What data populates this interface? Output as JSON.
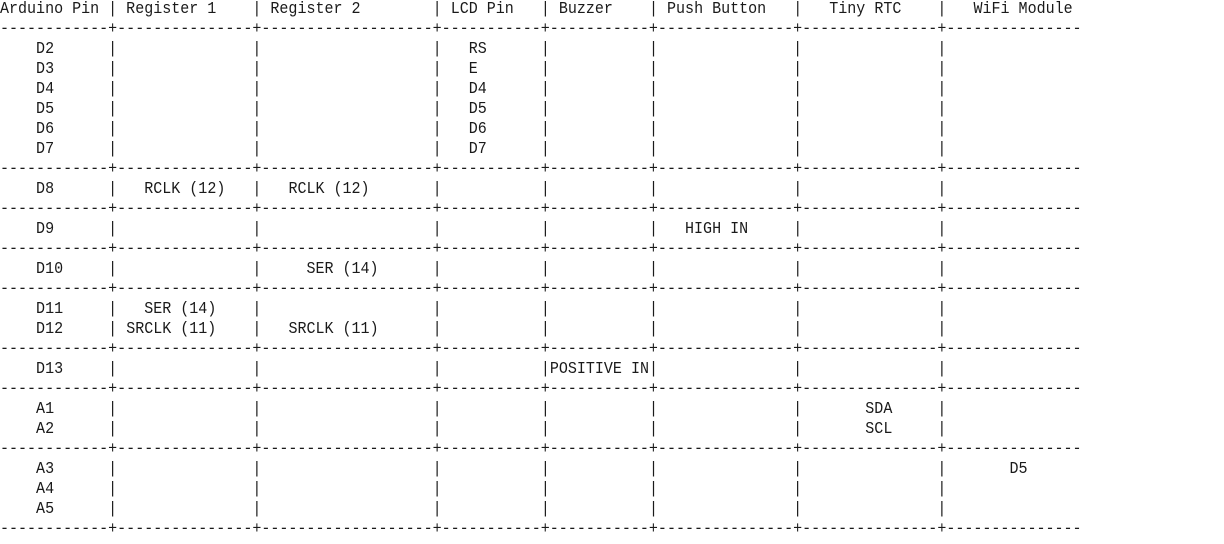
{
  "table": {
    "headers": [
      "Arduino Pin",
      "Register 1",
      "Register 2",
      "LCD Pin",
      "Buzzer",
      "Push Button",
      "Tiny RTC",
      "WiFi Module"
    ],
    "groups": [
      {
        "rows": [
          [
            "D2",
            "",
            "",
            "RS",
            "",
            "",
            "",
            ""
          ],
          [
            "D3",
            "",
            "",
            "E",
            "",
            "",
            "",
            ""
          ],
          [
            "D4",
            "",
            "",
            "D4",
            "",
            "",
            "",
            ""
          ],
          [
            "D5",
            "",
            "",
            "D5",
            "",
            "",
            "",
            ""
          ],
          [
            "D6",
            "",
            "",
            "D6",
            "",
            "",
            "",
            ""
          ],
          [
            "D7",
            "",
            "",
            "D7",
            "",
            "",
            "",
            ""
          ]
        ]
      },
      {
        "rows": [
          [
            "D8",
            "RCLK (12)",
            "RCLK (12)",
            "",
            "",
            "",
            "",
            ""
          ]
        ]
      },
      {
        "rows": [
          [
            "D9",
            "",
            "",
            "",
            "",
            "HIGH IN",
            "",
            ""
          ]
        ]
      },
      {
        "rows": [
          [
            "D10",
            "",
            "SER (14)",
            "",
            "",
            "",
            "",
            ""
          ]
        ]
      },
      {
        "rows": [
          [
            "D11",
            "SER (14)",
            "",
            "",
            "",
            "",
            "",
            ""
          ],
          [
            "D12",
            "SRCLK (11)",
            "SRCLK (11)",
            "",
            "",
            "",
            "",
            ""
          ]
        ]
      },
      {
        "rows": [
          [
            "D13",
            "",
            "",
            "",
            "POSITIVE IN",
            "",
            "",
            ""
          ]
        ]
      },
      {
        "rows": [
          [
            "A1",
            "",
            "",
            "",
            "",
            "",
            "SDA",
            ""
          ],
          [
            "A2",
            "",
            "",
            "",
            "",
            "",
            "SCL",
            ""
          ]
        ]
      },
      {
        "rows": [
          [
            "A3",
            "",
            "",
            "",
            "",
            "",
            "",
            "D5"
          ],
          [
            "A4",
            "",
            "",
            "",
            "",
            "",
            "",
            ""
          ],
          [
            "A5",
            "",
            "",
            "",
            "",
            "",
            "",
            ""
          ]
        ]
      }
    ]
  }
}
